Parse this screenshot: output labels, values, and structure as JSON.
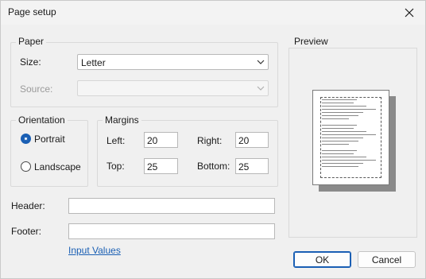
{
  "window": {
    "title": "Page setup"
  },
  "paper": {
    "legend": "Paper",
    "size_label": "Size:",
    "size_value": "Letter",
    "source_label": "Source:",
    "source_value": ""
  },
  "orientation": {
    "legend": "Orientation",
    "portrait_label": "Portrait",
    "landscape_label": "Landscape",
    "selected": "Portrait"
  },
  "margins": {
    "legend": "Margins",
    "left_label": "Left:",
    "left_value": "20",
    "right_label": "Right:",
    "right_value": "20",
    "top_label": "Top:",
    "top_value": "25",
    "bottom_label": "Bottom:",
    "bottom_value": "25"
  },
  "header": {
    "label": "Header:",
    "value": ""
  },
  "footer": {
    "label": "Footer:",
    "value": ""
  },
  "input_values_link": "Input Values",
  "preview": {
    "legend": "Preview"
  },
  "buttons": {
    "ok": "OK",
    "cancel": "Cancel"
  },
  "colors": {
    "accent": "#1a5fb4",
    "background": "#f0f0f0"
  },
  "icons": {
    "close": "close-icon",
    "chevron": "chevron-down-icon"
  }
}
